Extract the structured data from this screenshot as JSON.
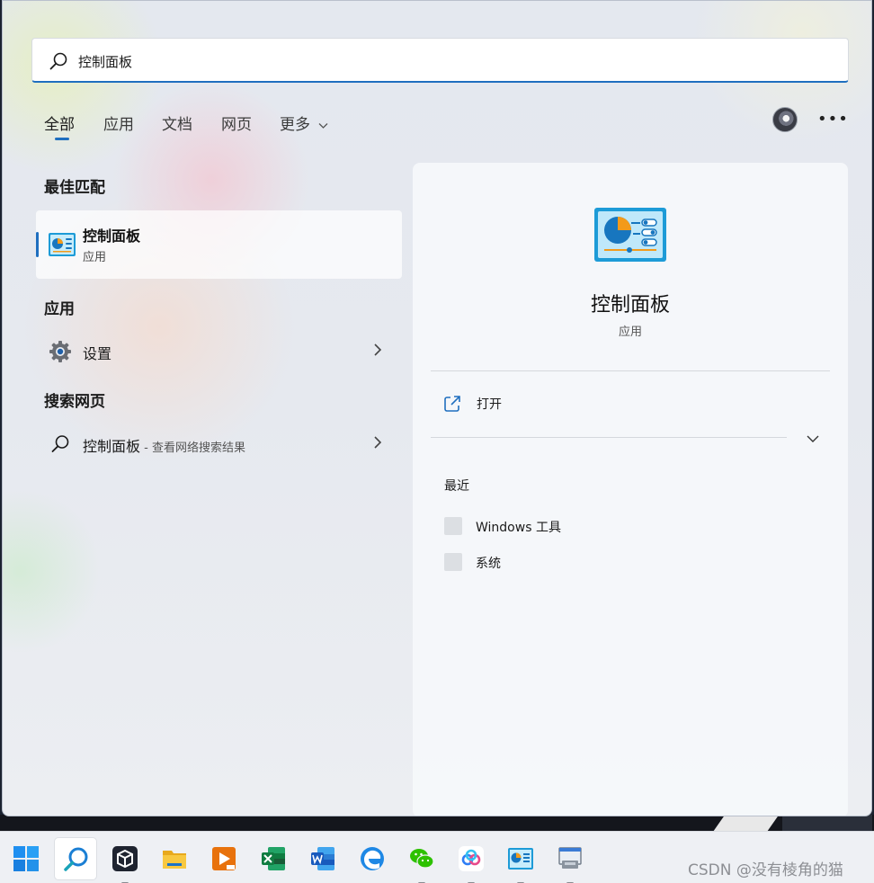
{
  "search": {
    "query": "控制面板"
  },
  "tabs": [
    {
      "label": "全部"
    },
    {
      "label": "应用"
    },
    {
      "label": "文档"
    },
    {
      "label": "网页"
    },
    {
      "label": "更多"
    }
  ],
  "left": {
    "best_match_head": "最佳匹配",
    "best_match": {
      "title": "控制面板",
      "subtitle": "应用"
    },
    "apps_head": "应用",
    "apps": [
      {
        "label": "设置"
      }
    ],
    "web_head": "搜索网页",
    "web": [
      {
        "label": "控制面板",
        "hint": " - 查看网络搜索结果"
      }
    ]
  },
  "detail": {
    "title": "控制面板",
    "subtitle": "应用",
    "actions": [
      {
        "label": "打开"
      }
    ],
    "recent_head": "最近",
    "recent": [
      {
        "label": "Windows 工具"
      },
      {
        "label": "系统"
      }
    ]
  },
  "taskbar": {
    "apps": [
      {
        "name": "start-icon"
      },
      {
        "name": "search-icon"
      },
      {
        "name": "virtualbox-icon"
      },
      {
        "name": "file-explorer-icon"
      },
      {
        "name": "presentation-app-icon"
      },
      {
        "name": "excel-icon"
      },
      {
        "name": "word-icon"
      },
      {
        "name": "edge-icon"
      },
      {
        "name": "wechat-icon"
      },
      {
        "name": "baidu-netdisk-icon"
      },
      {
        "name": "control-panel-icon"
      },
      {
        "name": "device-manager-icon"
      }
    ],
    "watermark": "CSDN @没有棱角的猫"
  },
  "colors": {
    "accent": "#1f6fbf",
    "panel_bg": "#e6e9ef",
    "detail_bg": "#f6f8fa"
  }
}
